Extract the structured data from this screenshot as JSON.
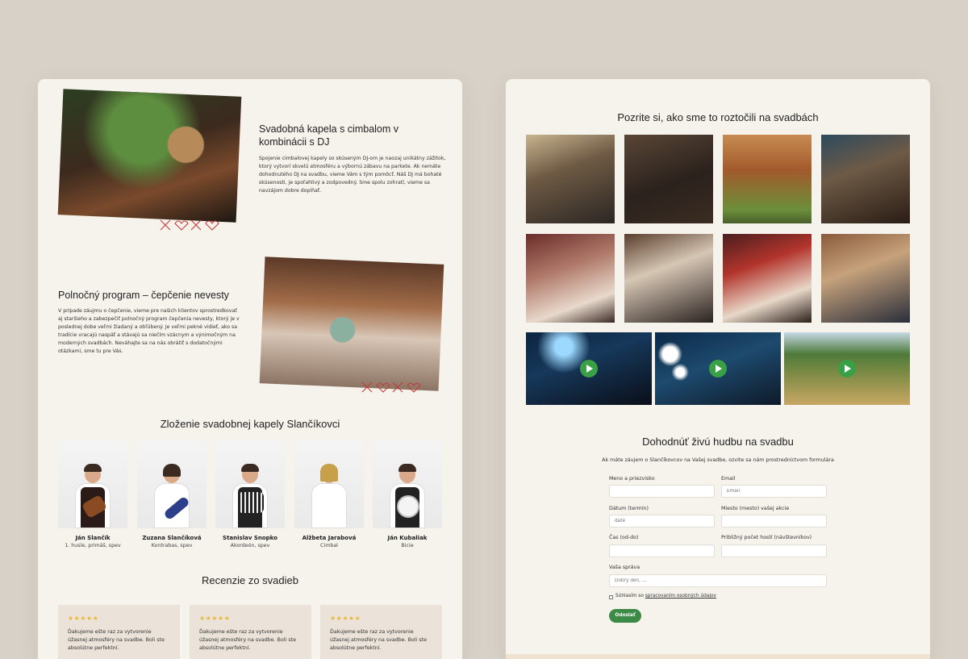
{
  "left": {
    "feature1": {
      "title": "Svadobná kapela s cimbalom v kombinácii s DJ",
      "text": "Spojenie cimbalovej kapely so skúseným DJ-om je naozaj unikátny zážitok, ktorý vytvorí skvelú atmosféru a výbornú zábavu na parkete. Ak nemáte dohodnutého DJ na svadbu, vieme Vám s tým pomôcť. Náš DJ má bohaté skúsenosti, je spoľahlivý a zodpovedný. Sme spolu zohratí, vieme sa navzájom dobre doplňať."
    },
    "feature2": {
      "title": "Polnočný program – čepčenie nevesty",
      "text": "V prípade záujmu o čepčenie, vieme pre našich klientov sprostredkovať aj staršieho a zabezpečiť polnočný program čepčenia nevesty, ktorý je v poslednej dobe veľmi žiadaný a obľúbený. Je veľmi pekné vidieť, ako sa tradície vracajú naspäť a stávajú sa niečím vzácnym a výnimočným na moderných svadbách. Neváhajte sa na nás obrátiť s dodatočnými otázkami, sme tu pre Vás."
    },
    "band": {
      "title": "Zloženie svadobnej kapely Slančíkovci",
      "members": [
        {
          "name": "Ján Slančík",
          "role": "1. husle, primáš, spev",
          "instrument": "violin"
        },
        {
          "name": "Zuzana Slančíková",
          "role": "Kontrabas, spev",
          "instrument": "bass-guitar"
        },
        {
          "name": "Stanislav Snopko",
          "role": "Akordeón, spev",
          "instrument": "accordion"
        },
        {
          "name": "Alžbeta Jarabová",
          "role": "Cimbal",
          "instrument": "cimbalom"
        },
        {
          "name": "Ján Kubaliak",
          "role": "Bicie",
          "instrument": "drum"
        }
      ]
    },
    "reviews": {
      "title": "Recenzie zo svadieb",
      "items": [
        {
          "stars": "★★★★★",
          "text": "Ďakujeme ešte raz za vytvorenie úžasnej atmosféry na svadbe. Boli ste absolútne perfektní."
        },
        {
          "stars": "★★★★★",
          "text": "Ďakujeme ešte raz za vytvorenie úžasnej atmosféry na svadbe. Boli ste absolútne perfektní."
        },
        {
          "stars": "★★★★★",
          "text": "Ďakujeme ešte raz za vytvorenie úžasnej atmosféry na svadbe. Boli ste absolútne perfektní."
        }
      ]
    }
  },
  "right": {
    "gallery": {
      "title": "Pozrite si, ako sme to roztočili na svadbách",
      "photo_count": 8,
      "video_count": 3
    },
    "form": {
      "title": "Dohodnúť živú hudbu na svadbu",
      "intro": "Ak máte záujem o Slančíkovcov na Vašej svadbe, ozvite sa nám prostredníctvom formulára",
      "name_label": "Meno a priezvisko",
      "name_value": "",
      "email_label": "Email",
      "email_placeholder": "Email",
      "date_label": "Dátum (termín)",
      "date_placeholder": "date",
      "place_label": "Miesto (mesto) vašej akcie",
      "place_value": "",
      "time_label": "Čas (od-do)",
      "time_value": "",
      "guests_label": "Približný počet hostí (návštevníkov)",
      "guests_value": "",
      "message_label": "Vaša správa",
      "message_placeholder": "Dobrý deň, ...",
      "consent_text": "Súhlasím so ",
      "consent_link": "spracovaním osobných údajov",
      "submit_label": "Odoslať"
    }
  },
  "colors": {
    "background": "#d8d1c8",
    "panel": "#f6f2ec",
    "accent_green": "#3b8a46",
    "star": "#e8b83a",
    "deco_red": "#c53a3a"
  }
}
